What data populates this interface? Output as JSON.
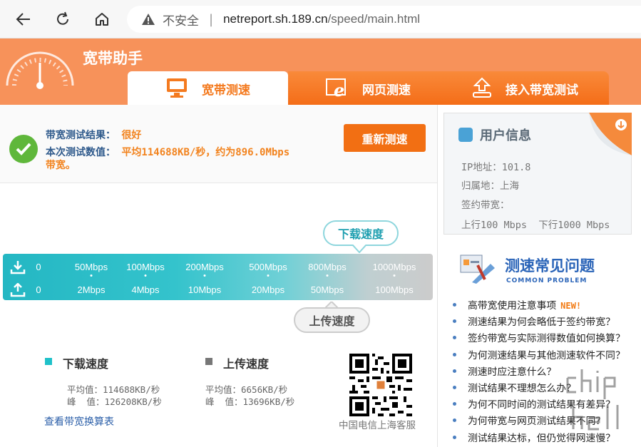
{
  "browser": {
    "insecure_label": "不安全",
    "url_host": "netreport.sh.189.cn",
    "url_path": "/speed/main.html"
  },
  "header": {
    "brand": "宽带助手",
    "tabs": [
      {
        "label": "宽带测速",
        "active": true
      },
      {
        "label": "网页测速",
        "active": false
      },
      {
        "label": "接入带宽测试",
        "active": false
      }
    ]
  },
  "result": {
    "status_label": "带宽测试结果：",
    "status_value": "很好",
    "value_label": "本次测试数值：",
    "value_text": "平均114688KB/秒，约为896.0Mbps",
    "value_text_2": "带宽。",
    "retest_button": "重新测速"
  },
  "speed_scale": {
    "download_bubble": "下载速度",
    "upload_bubble": "上传速度",
    "download_ticks": [
      "0",
      "50Mbps",
      "100Mbps",
      "200Mbps",
      "500Mbps",
      "800Mbps",
      "1000Mbps"
    ],
    "upload_ticks": [
      "0",
      "2Mbps",
      "4Mbps",
      "10Mbps",
      "20Mbps",
      "50Mbps",
      "100Mbps"
    ]
  },
  "stats": {
    "download": {
      "title": "下载速度",
      "avg": "平均值：114688KB/秒",
      "peak": "峰  值：126208KB/秒",
      "color": "#1fc1c9"
    },
    "upload": {
      "title": "上传速度",
      "avg": "平均值：6656KB/秒",
      "peak": "峰  值：13696KB/秒",
      "color": "#777777"
    },
    "converter_link": "查看带宽换算表",
    "qr_caption": "中国电信上海客服"
  },
  "user_info": {
    "title": "用户信息",
    "ip": "IP地址：101.8",
    "location": "归属地：上海",
    "contract_label": "签约带宽：",
    "contract_value": "上行100 Mbps  下行1000 Mbps"
  },
  "faq": {
    "title": "测速常见问题",
    "subtitle": "COMMON PROBLEM",
    "new_badge": "NEW!",
    "items": [
      "高带宽使用注意事项",
      "测速结果为何会略低于签约带宽？",
      "签约带宽与实际测得数值如何换算？",
      "为何测速结果与其他测速软件不同？",
      "测速时应注意什么？",
      "测试结果不理想怎么办？",
      "为何不同时间的测试结果有差异？",
      "为何带宽与网页测试结果不同？",
      "测试结果达标，但仍觉得网速慢？"
    ]
  },
  "colors": {
    "header_orange": "#f7925a",
    "tab_orange": "#f46d18",
    "accent_teal": "#24b7c3",
    "link_blue": "#2a5ea8"
  }
}
